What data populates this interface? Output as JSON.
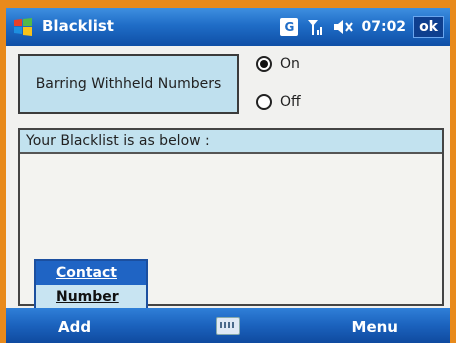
{
  "app": {
    "title": "Blacklist"
  },
  "status": {
    "network_badge": "G",
    "time": "07:02",
    "ok_label": "ok",
    "signal_icon": "signal-icon",
    "volume_icon": "speaker-muted-icon"
  },
  "barring": {
    "label": "Barring Withheld Numbers",
    "options": [
      {
        "label": "On",
        "selected": true
      },
      {
        "label": "Off",
        "selected": false
      }
    ]
  },
  "list": {
    "header": "Your Blacklist is as below :"
  },
  "popup": {
    "items": [
      {
        "label": "Contact",
        "selected": true
      },
      {
        "label": "Number",
        "selected": false
      }
    ]
  },
  "softkeys": {
    "left": "Add",
    "right": "Menu"
  },
  "colors": {
    "frame": "#e88a1c",
    "titlebar": "#1f6dc7",
    "panel": "#bfe0ee",
    "selection": "#1f64c4"
  }
}
